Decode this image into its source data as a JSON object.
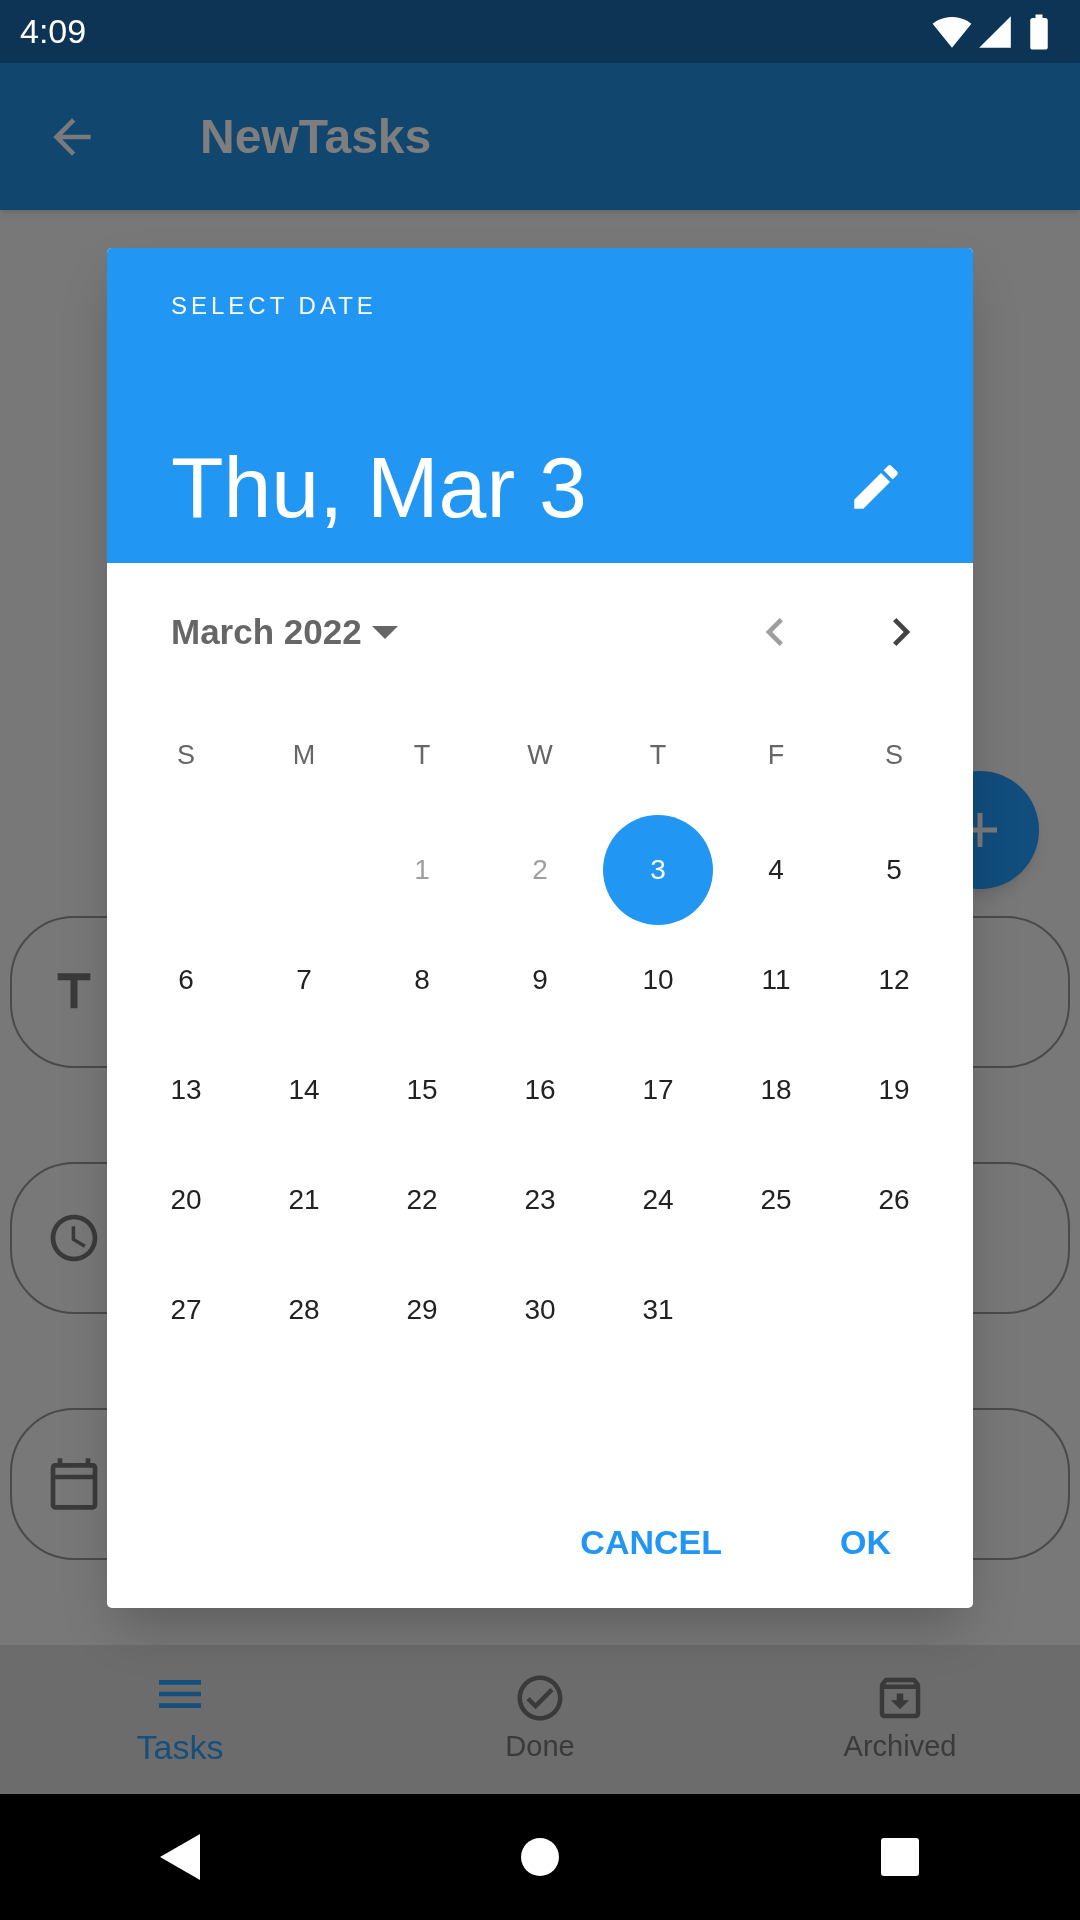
{
  "status_bar": {
    "time": "4:09"
  },
  "app_bar": {
    "title": "NewTasks"
  },
  "date_picker": {
    "header_label": "SELECT DATE",
    "selected_date": "Thu, Mar 3",
    "month_label": "March 2022",
    "prev_month": {
      "disabled": true
    },
    "next_month": {
      "disabled": false
    },
    "weekdays": [
      "S",
      "M",
      "T",
      "W",
      "T",
      "F",
      "S"
    ],
    "weeks": [
      [
        {
          "kind": "blank"
        },
        {
          "kind": "blank"
        },
        {
          "kind": "day",
          "label": "1",
          "disabled": true,
          "selected": false
        },
        {
          "kind": "day",
          "label": "2",
          "disabled": true,
          "selected": false
        },
        {
          "kind": "day",
          "label": "3",
          "disabled": false,
          "selected": true
        },
        {
          "kind": "day",
          "label": "4",
          "disabled": false,
          "selected": false
        },
        {
          "kind": "day",
          "label": "5",
          "disabled": false,
          "selected": false
        }
      ],
      [
        {
          "kind": "day",
          "label": "6",
          "disabled": false,
          "selected": false
        },
        {
          "kind": "day",
          "label": "7",
          "disabled": false,
          "selected": false
        },
        {
          "kind": "day",
          "label": "8",
          "disabled": false,
          "selected": false
        },
        {
          "kind": "day",
          "label": "9",
          "disabled": false,
          "selected": false
        },
        {
          "kind": "day",
          "label": "10",
          "disabled": false,
          "selected": false
        },
        {
          "kind": "day",
          "label": "11",
          "disabled": false,
          "selected": false
        },
        {
          "kind": "day",
          "label": "12",
          "disabled": false,
          "selected": false
        }
      ],
      [
        {
          "kind": "day",
          "label": "13",
          "disabled": false,
          "selected": false
        },
        {
          "kind": "day",
          "label": "14",
          "disabled": false,
          "selected": false
        },
        {
          "kind": "day",
          "label": "15",
          "disabled": false,
          "selected": false
        },
        {
          "kind": "day",
          "label": "16",
          "disabled": false,
          "selected": false
        },
        {
          "kind": "day",
          "label": "17",
          "disabled": false,
          "selected": false
        },
        {
          "kind": "day",
          "label": "18",
          "disabled": false,
          "selected": false
        },
        {
          "kind": "day",
          "label": "19",
          "disabled": false,
          "selected": false
        }
      ],
      [
        {
          "kind": "day",
          "label": "20",
          "disabled": false,
          "selected": false
        },
        {
          "kind": "day",
          "label": "21",
          "disabled": false,
          "selected": false
        },
        {
          "kind": "day",
          "label": "22",
          "disabled": false,
          "selected": false
        },
        {
          "kind": "day",
          "label": "23",
          "disabled": false,
          "selected": false
        },
        {
          "kind": "day",
          "label": "24",
          "disabled": false,
          "selected": false
        },
        {
          "kind": "day",
          "label": "25",
          "disabled": false,
          "selected": false
        },
        {
          "kind": "day",
          "label": "26",
          "disabled": false,
          "selected": false
        }
      ],
      [
        {
          "kind": "day",
          "label": "27",
          "disabled": false,
          "selected": false
        },
        {
          "kind": "day",
          "label": "28",
          "disabled": false,
          "selected": false
        },
        {
          "kind": "day",
          "label": "29",
          "disabled": false,
          "selected": false
        },
        {
          "kind": "day",
          "label": "30",
          "disabled": false,
          "selected": false
        },
        {
          "kind": "day",
          "label": "31",
          "disabled": false,
          "selected": false
        },
        {
          "kind": "blank"
        },
        {
          "kind": "blank"
        }
      ]
    ],
    "buttons": [
      "CANCEL",
      "OK"
    ]
  },
  "bottom_nav": [
    {
      "label": "Tasks",
      "selected": true
    },
    {
      "label": "Done",
      "selected": false
    },
    {
      "label": "Archived",
      "selected": false
    }
  ]
}
